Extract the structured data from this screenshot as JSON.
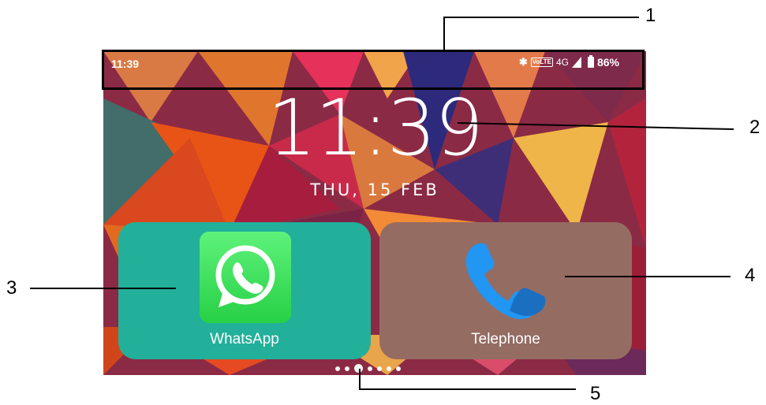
{
  "status_bar": {
    "time": "11:39",
    "network_type": "4G",
    "network_superscript": "4G",
    "volte": "VoLTE",
    "battery": "86%",
    "icons": [
      "bluetooth-icon",
      "volte-icon",
      "signal-icon",
      "battery-icon"
    ]
  },
  "lockscreen": {
    "clock": "11:39",
    "date": "THU, 15 FEB"
  },
  "tiles": [
    {
      "label": "WhatsApp",
      "icon": "whatsapp-icon",
      "color": "#22b09a"
    },
    {
      "label": "Telephone",
      "icon": "phone-icon",
      "color": "#956c62"
    }
  ],
  "page_indicator": {
    "count": 7,
    "active_index": 2
  },
  "callouts": [
    "1",
    "2",
    "3",
    "4",
    "5"
  ]
}
